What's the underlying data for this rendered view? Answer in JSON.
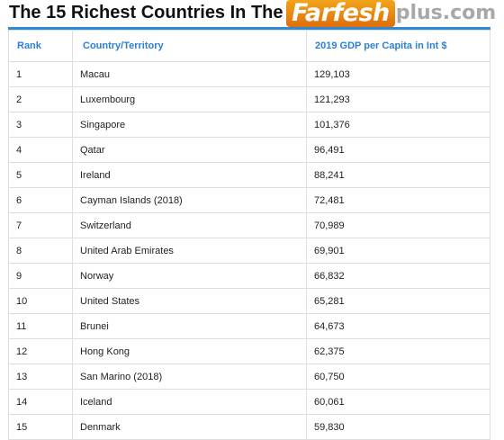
{
  "title": "The 15 Richest Countries In The World",
  "watermark": {
    "brand": "Farfesh",
    "site": "plus.com"
  },
  "table": {
    "headers": {
      "rank": "Rank",
      "country": "Country/Territory",
      "gdp": "2019 GDP per Capita in Int $"
    },
    "rows": [
      {
        "rank": "1",
        "country": "Macau",
        "gdp": "129,103"
      },
      {
        "rank": "2",
        "country": "Luxembourg",
        "gdp": "121,293"
      },
      {
        "rank": "3",
        "country": "Singapore",
        "gdp": "101,376"
      },
      {
        "rank": "4",
        "country": "Qatar",
        "gdp": "96,491"
      },
      {
        "rank": "5",
        "country": "Ireland",
        "gdp": "88,241"
      },
      {
        "rank": "6",
        "country": "Cayman Islands (2018)",
        "gdp": "72,481"
      },
      {
        "rank": "7",
        "country": "Switzerland",
        "gdp": "70,989"
      },
      {
        "rank": "8",
        "country": "United Arab Emirates",
        "gdp": "69,901"
      },
      {
        "rank": "9",
        "country": "Norway",
        "gdp": "66,832"
      },
      {
        "rank": "10",
        "country": "United States",
        "gdp": "65,281"
      },
      {
        "rank": "11",
        "country": "Brunei",
        "gdp": "64,673"
      },
      {
        "rank": "12",
        "country": "Hong Kong",
        "gdp": "62,375"
      },
      {
        "rank": "13",
        "country": "San Marino (2018)",
        "gdp": "60,750"
      },
      {
        "rank": "14",
        "country": "Iceland",
        "gdp": "60,061"
      },
      {
        "rank": "15",
        "country": "Denmark",
        "gdp": "59,830"
      }
    ]
  }
}
